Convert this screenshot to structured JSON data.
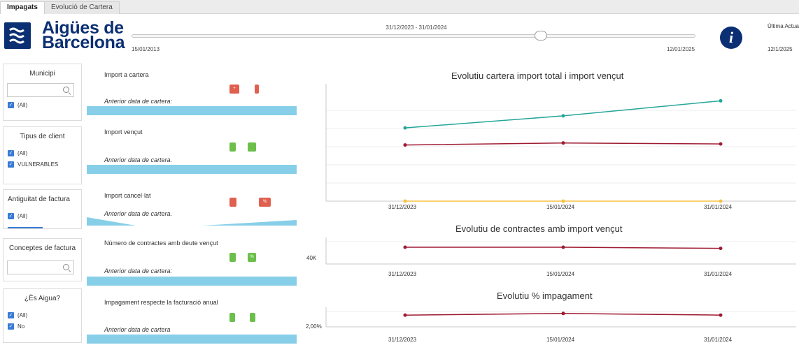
{
  "tabs": [
    {
      "label": "Impagats",
      "active": true
    },
    {
      "label": "Evolució de Cartera",
      "active": false
    }
  ],
  "header": {
    "logo_line1": "Aigües de",
    "logo_line2": "Barcelona",
    "date_range": "31/12/2023 - 31/01/2024",
    "slider_min": "15/01/2013",
    "slider_max": "12/01/2025",
    "info_icon": "i",
    "last_update_label": "Última Actualització",
    "last_update_date": "12/1/2025"
  },
  "filters": {
    "municipi": {
      "title": "Municipi",
      "options": [
        "(All)"
      ]
    },
    "tipus_client": {
      "title": "Tipus de client",
      "options": [
        "(All)",
        "VULNERABLES"
      ]
    },
    "antiguitat": {
      "title": "Antiguitat de factura",
      "options": [
        "(All)"
      ]
    },
    "conceptes": {
      "title": "Conceptes de factura"
    },
    "es_aigua": {
      "title": "¿Ès Aigua?",
      "options": [
        "(All)",
        "No"
      ]
    }
  },
  "kpis": [
    {
      "title": "Import a cartera",
      "sub": "Anterior data de cartera:",
      "badge_text": "+",
      "badge_color": "red"
    },
    {
      "title": "Import vençut",
      "sub": "Anterior data de cartera.",
      "badge_text": "",
      "badge_color": "green"
    },
    {
      "title": "Import cancel·lat",
      "sub": "Anterior data de cartera.",
      "badge_text": "%",
      "badge_color": "red"
    },
    {
      "title": "Número de contractes amb deute vençut",
      "sub": "Anterior data de cartera:",
      "badge_text": "%",
      "badge_color": "green"
    },
    {
      "title": "Impagament respecte la facturació anual",
      "sub": "Anterior data de cartera",
      "badge_text": "",
      "badge_color": "green"
    }
  ],
  "colors": {
    "brand": "#0b2f73",
    "teal": "#26a69a",
    "darkred": "#9e1b32",
    "yellow": "#f5c242",
    "band": "#87cfe8"
  },
  "chart_data": [
    {
      "type": "line",
      "title": "Evolutiu cartera import total i import vençut",
      "x": [
        "31/12/2023",
        "15/01/2024",
        "31/01/2024"
      ],
      "series": [
        {
          "values": [
            0.73,
            0.85,
            1.0
          ],
          "color": "#26a69a"
        },
        {
          "values": [
            0.56,
            0.58,
            0.57
          ],
          "color": "#9e1b32"
        },
        {
          "values": [
            0.0,
            0.0,
            0.0
          ],
          "color": "#f5c242"
        }
      ],
      "ylim": [
        0,
        1.1
      ],
      "grid": true
    },
    {
      "type": "line",
      "title": "Evolutiu de contractes amb import vençut",
      "x": [
        "31/12/2023",
        "15/01/2024",
        "31/01/2024"
      ],
      "y_ticks": [
        "40K"
      ],
      "series": [
        {
          "values": [
            44500,
            44500,
            44200
          ],
          "color": "#9e1b32"
        }
      ],
      "ylim": [
        40000,
        46000
      ],
      "grid": true
    },
    {
      "type": "line",
      "title": "Evolutiu % impagament",
      "x": [
        "31/12/2023",
        "15/01/2024",
        "31/01/2024"
      ],
      "y_ticks": [
        "2,00%"
      ],
      "series": [
        {
          "values": [
            2.07,
            2.08,
            2.07
          ],
          "color": "#9e1b32"
        }
      ],
      "ylim": [
        2.0,
        2.1
      ],
      "grid": true
    }
  ]
}
